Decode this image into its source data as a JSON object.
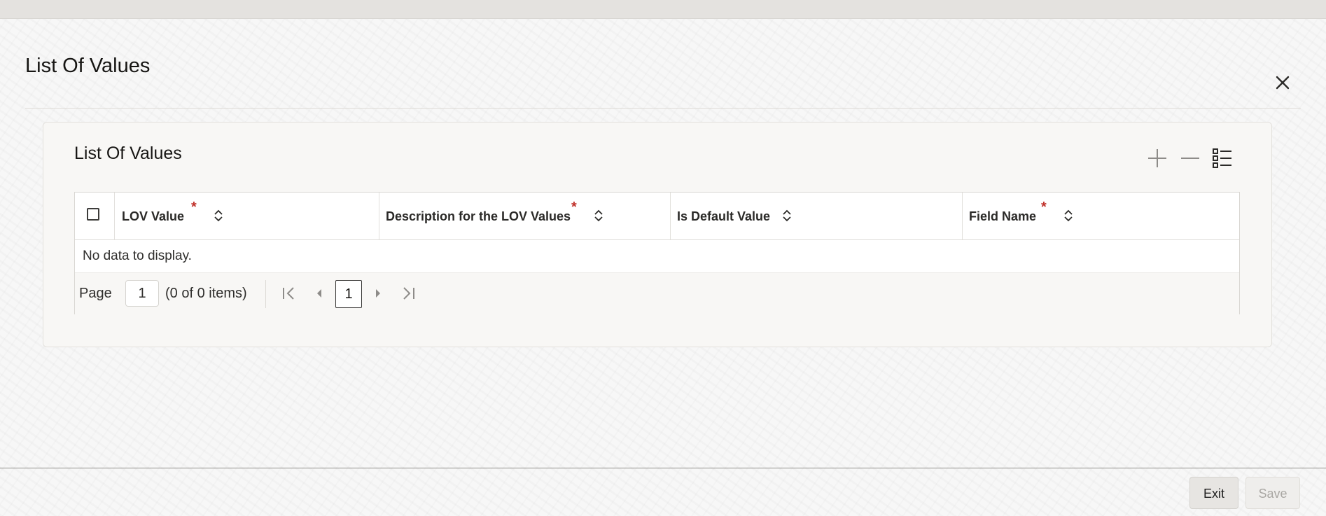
{
  "dialog": {
    "title": "List Of Values",
    "close_icon": "close-icon"
  },
  "panel": {
    "title": "List Of Values",
    "toolbar": {
      "add_icon": "plus-icon",
      "remove_icon": "minus-icon",
      "view_icon": "list-view-icon"
    }
  },
  "grid": {
    "columns": [
      {
        "label": "LOV Value",
        "required_mark": "*"
      },
      {
        "label": "Description for the LOV Values",
        "required_mark": "*"
      },
      {
        "label": "Is Default Value",
        "required_mark": ""
      },
      {
        "label": "Field Name",
        "required_mark": "*"
      }
    ],
    "empty_message": "No data to display.",
    "pagination": {
      "page_label": "Page",
      "page_value": "1",
      "items_summary": "(0 of 0 items)",
      "current_page": "1"
    }
  },
  "footer": {
    "exit_label": "Exit",
    "save_label": "Save"
  },
  "colors": {
    "required": "#c0312b",
    "disabled_text": "#a9a7a3",
    "icon_gray": "#8e8c89"
  }
}
